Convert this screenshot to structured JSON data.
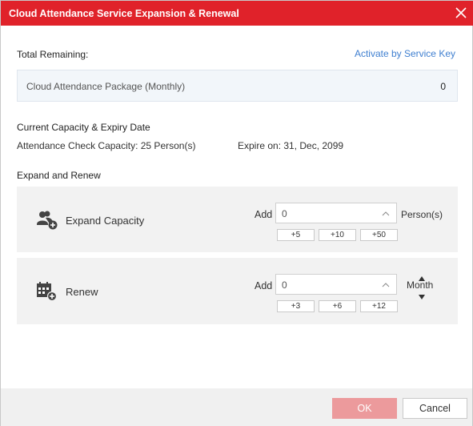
{
  "dialog": {
    "title": "Cloud Attendance Service Expansion & Renewal",
    "accent_color": "#e0222a",
    "close_icon": "close-icon"
  },
  "total": {
    "label": "Total Remaining:",
    "activate_link": "Activate by Service Key",
    "package_name": "Cloud Attendance Package (Monthly)",
    "package_count": "0"
  },
  "capacity": {
    "title": "Current Capacity & Expiry Date",
    "capacity_text": "Attendance Check Capacity: 25 Person(s)",
    "expire_text": "Expire on: 31, Dec, 2099"
  },
  "expand_renew": {
    "title": "Expand and Renew",
    "expand": {
      "icon": "add-user-icon",
      "label": "Expand Capacity",
      "add_label": "Add",
      "value": "0",
      "unit": "Person(s)",
      "quick": [
        "+5",
        "+10",
        "+50"
      ]
    },
    "renew": {
      "icon": "calendar-add-icon",
      "label": "Renew",
      "add_label": "Add",
      "value": "0",
      "unit": "Month",
      "quick": [
        "+3",
        "+6",
        "+12"
      ]
    }
  },
  "footer": {
    "ok_label": "OK",
    "cancel_label": "Cancel",
    "ok_color": "#ec9a9c"
  }
}
